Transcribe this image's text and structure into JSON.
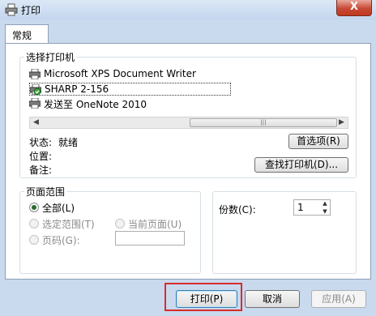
{
  "window": {
    "title": "打印",
    "close_glyph": "X"
  },
  "tabs": [
    {
      "label": "常规"
    }
  ],
  "select_printer": {
    "group_label": "选择打印机",
    "printers": [
      {
        "name": "Microsoft XPS Document Writer",
        "selected": false,
        "default": false
      },
      {
        "name": "SHARP 2-156",
        "selected": true,
        "default": true
      },
      {
        "name": "发送至 OneNote 2010",
        "selected": false,
        "default": false
      }
    ],
    "scroll_thumb_glyph": "|||"
  },
  "status": {
    "status_label": "状态:",
    "status_value": "就绪",
    "location_label": "位置:",
    "comment_label": "备注:",
    "preferences_button": "首选项(R)",
    "find_printer_button": "查找打印机(D)..."
  },
  "page_range": {
    "group_label": "页面范围",
    "all_label": "全部(L)",
    "selection_label": "选定范围(T)",
    "current_page_label": "当前页面(U)",
    "pages_label": "页码(G):",
    "pages_value": "",
    "selected_option": "all"
  },
  "copies": {
    "label": "份数(C):",
    "value": "1"
  },
  "footer": {
    "print_button": "打印(P)",
    "cancel_button": "取消",
    "apply_button": "应用(A)",
    "highlight_color": "#d92b2b"
  }
}
